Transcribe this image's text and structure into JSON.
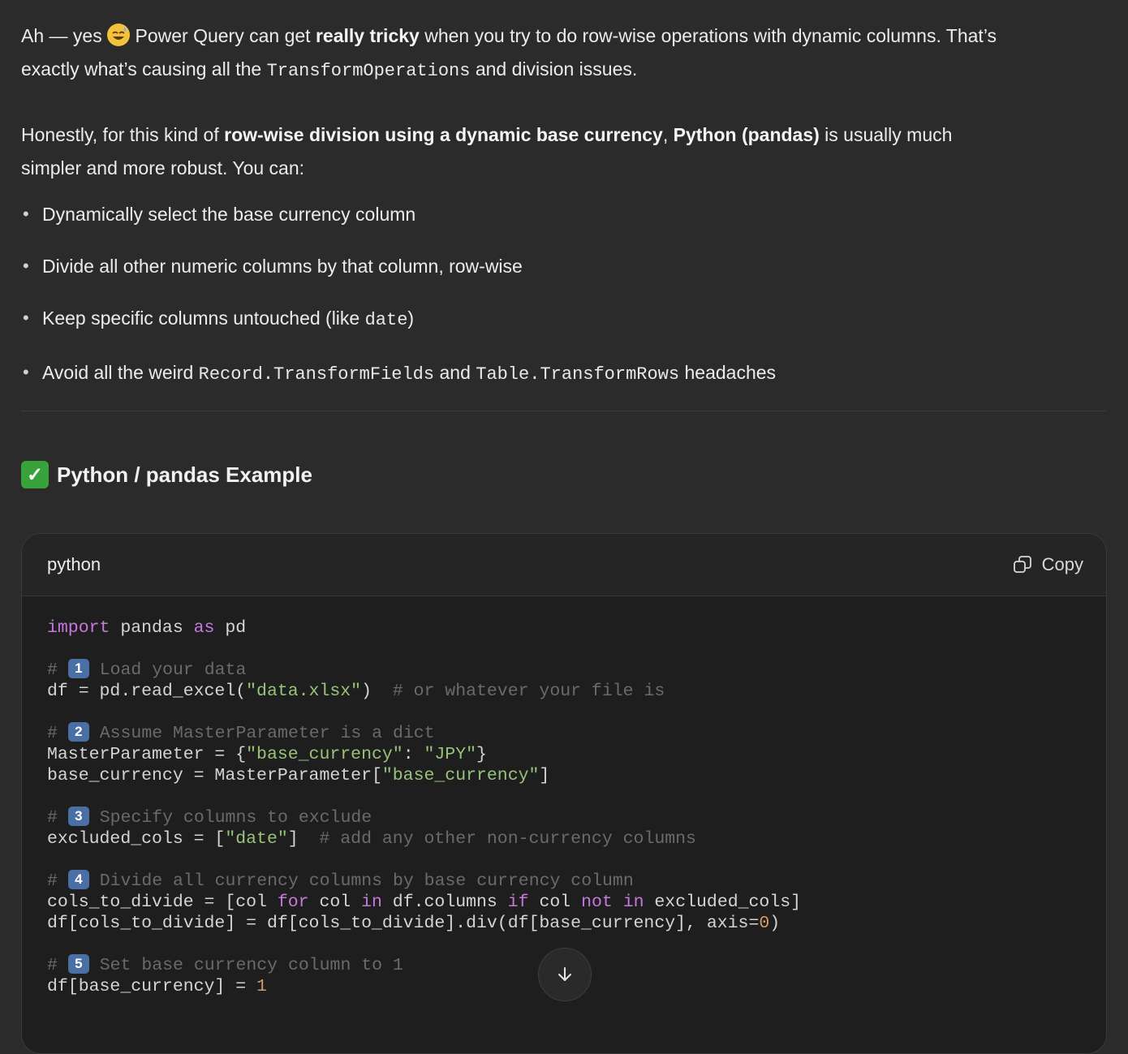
{
  "intro": {
    "p1_a": "Ah — yes",
    "p1_b": "Power Query can get",
    "p1_bold": "really tricky",
    "p1_c": "when you try to do row-wise operations with dynamic columns. That’s",
    "p1_d": "exactly what’s causing all the",
    "p1_code": "TransformOperations",
    "p1_e": "and division issues.",
    "p2_a": "Honestly, for this kind of",
    "p2_bold1": "row-wise division using a dynamic base currency",
    "p2_b": ",",
    "p2_bold2": "Python (pandas)",
    "p2_c": "is usually much",
    "p2_d": "simpler and more robust. You can:"
  },
  "bullets": {
    "b1": "Dynamically select the base currency column",
    "b2": "Divide all other numeric columns by that column, row-wise",
    "b3_a": "Keep specific columns untouched (like",
    "b3_code": "date",
    "b3_b": ")",
    "b4_a": "Avoid all the weird",
    "b4_code1": "Record.TransformFields",
    "b4_b": "and",
    "b4_code2": "Table.TransformRows",
    "b4_c": "headaches"
  },
  "section": {
    "check": "✓",
    "title": "Python / pandas Example"
  },
  "codeblock": {
    "language": "python",
    "copy_label": "Copy",
    "badges": [
      "1",
      "2",
      "3",
      "4",
      "5"
    ],
    "c1": " Load your data",
    "c2": " Assume MasterParameter is a dict",
    "c3": " Specify columns to exclude",
    "c4": " Divide all currency columns by base currency column",
    "c5": " Set base currency column to 1",
    "inline1": "  # or whatever your file is",
    "inline2": "  # add any other non-currency columns"
  },
  "icons": {
    "copy": "copy-icon",
    "scroll": "arrow-down-icon",
    "emoji": "sweat-smile-emoji",
    "check": "check-mark-icon"
  },
  "colors": {
    "background": "#2b2b2b",
    "code_bg": "#1e1e1e",
    "keyword": "#c678dd",
    "string": "#98c379",
    "number": "#d19a66",
    "comment": "#6a6a6a"
  }
}
